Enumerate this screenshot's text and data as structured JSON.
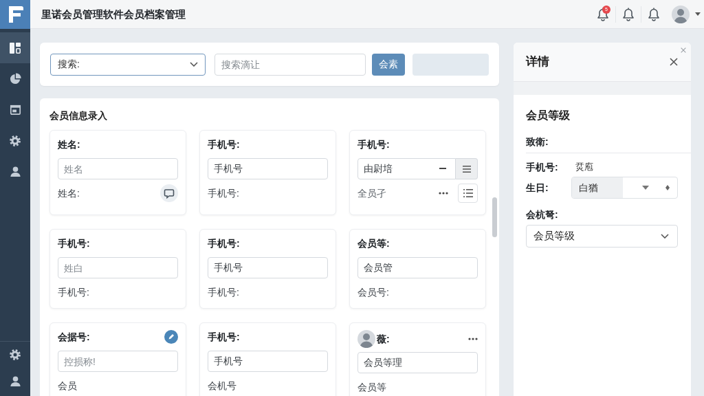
{
  "app": {
    "title": "里诺会员管理软件会员档案管理",
    "notification_badge": "5"
  },
  "sidebar": {
    "items": [
      {
        "selected": true
      },
      {
        "selected": false
      },
      {
        "selected": false
      },
      {
        "selected": false
      },
      {
        "selected": false
      }
    ],
    "bottom_items": [
      {
        "selected": false
      },
      {
        "selected": false
      }
    ]
  },
  "search_bar": {
    "select_label": "搜索:",
    "filter_placeholder": "搜索滴让",
    "search_button": "会素",
    "extra_button": {
      "disabled": true
    }
  },
  "member_form": {
    "title": "会员信息录入",
    "cards": [
      {
        "kind": "chat",
        "label": "姓名:",
        "input": {
          "placeholder": "姓名"
        },
        "footer": "姓名:"
      },
      {
        "kind": "plain",
        "label": "手机号:",
        "input": {
          "value": "手机号"
        },
        "footer": "手机号:"
      },
      {
        "kind": "group",
        "label": "手机号:",
        "input": {
          "value": "由尉培"
        },
        "footer": "全员孑"
      },
      {
        "kind": "plain",
        "label": "手机号:",
        "input": {
          "placeholder": "姓白"
        },
        "footer": "手机号:"
      },
      {
        "kind": "plain",
        "label": "手机号:",
        "input": {
          "value": "手机号"
        },
        "footer": "手机号:"
      },
      {
        "kind": "plain",
        "label": "会员等:",
        "input": {
          "value": "会员管"
        },
        "footer": "会员号:"
      },
      {
        "kind": "flagged",
        "label": "会据号:",
        "input": {
          "placeholder": "控损称!"
        },
        "footer": "会员"
      },
      {
        "kind": "plain",
        "label": "手机号:",
        "input": {
          "value": "手机号"
        },
        "footer": "会机号"
      },
      {
        "kind": "profile",
        "label": "薇:",
        "input": {
          "value": "会员等理"
        },
        "footer": "会员等"
      }
    ]
  },
  "detail": {
    "title": "详情",
    "section": "会员等级",
    "fields": [
      {
        "kind": "label",
        "label": "致衛:"
      },
      {
        "kind": "text",
        "label": "手机号:",
        "value": "烎庖"
      },
      {
        "kind": "picker",
        "label": "生日:",
        "value": "白猶"
      },
      {
        "kind": "select",
        "label": "会杭弩:",
        "value": "会员等级"
      }
    ]
  }
}
